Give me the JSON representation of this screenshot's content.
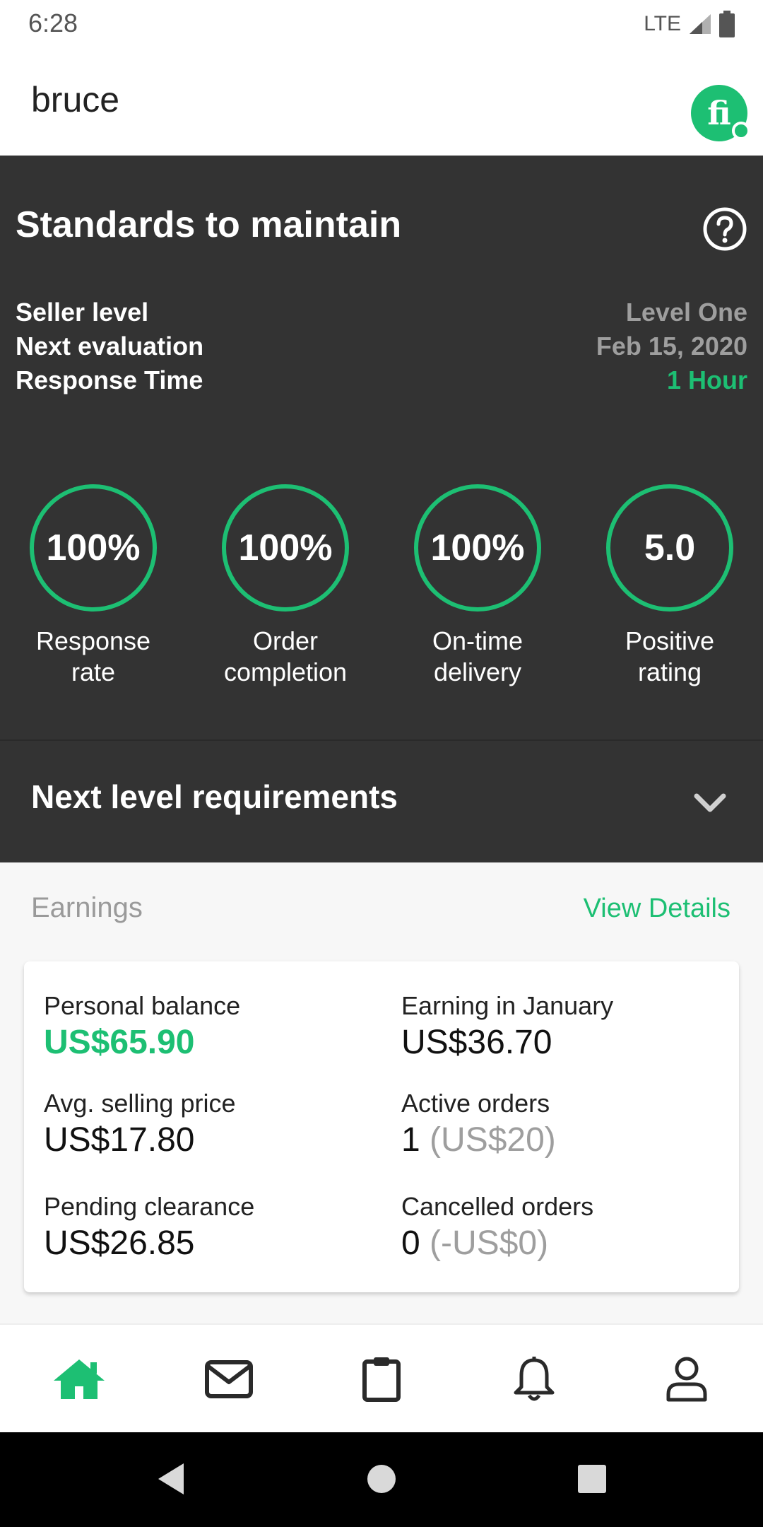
{
  "status_bar": {
    "time": "6:28",
    "network": "LTE"
  },
  "header": {
    "username": "bruce",
    "avatar_text": "fi"
  },
  "standards": {
    "title": "Standards to maintain",
    "rows": [
      {
        "label": "Seller level",
        "value": "Level One"
      },
      {
        "label": "Next evaluation",
        "value": "Feb 15, 2020"
      },
      {
        "label": "Response Time",
        "value": "1 Hour"
      }
    ],
    "metrics": [
      {
        "value": "100%",
        "label_line1": "Response",
        "label_line2": "rate"
      },
      {
        "value": "100%",
        "label_line1": "Order",
        "label_line2": "completion"
      },
      {
        "value": "100%",
        "label_line1": "On-time",
        "label_line2": "delivery"
      },
      {
        "value": "5.0",
        "label_line1": "Positive",
        "label_line2": "rating"
      }
    ],
    "next_level_label": "Next level requirements"
  },
  "earnings": {
    "title": "Earnings",
    "view_details": "View Details",
    "personal_balance_label": "Personal balance",
    "personal_balance_value": "US$65.90",
    "earning_month_label": "Earning in January",
    "earning_month_value": "US$36.70",
    "avg_price_label": "Avg. selling price",
    "avg_price_value": "US$17.80",
    "active_orders_label": "Active orders",
    "active_orders_count": "1",
    "active_orders_amount": "(US$20)",
    "pending_label": "Pending clearance",
    "pending_value": "US$26.85",
    "cancelled_label": "Cancelled orders",
    "cancelled_count": "0",
    "cancelled_amount": "(-US$0)"
  },
  "colors": {
    "accent": "#1dbf73",
    "dark_bg": "#333333"
  },
  "bottom_nav": [
    "home-icon",
    "inbox-icon",
    "orders-icon",
    "notifications-icon",
    "profile-icon"
  ]
}
